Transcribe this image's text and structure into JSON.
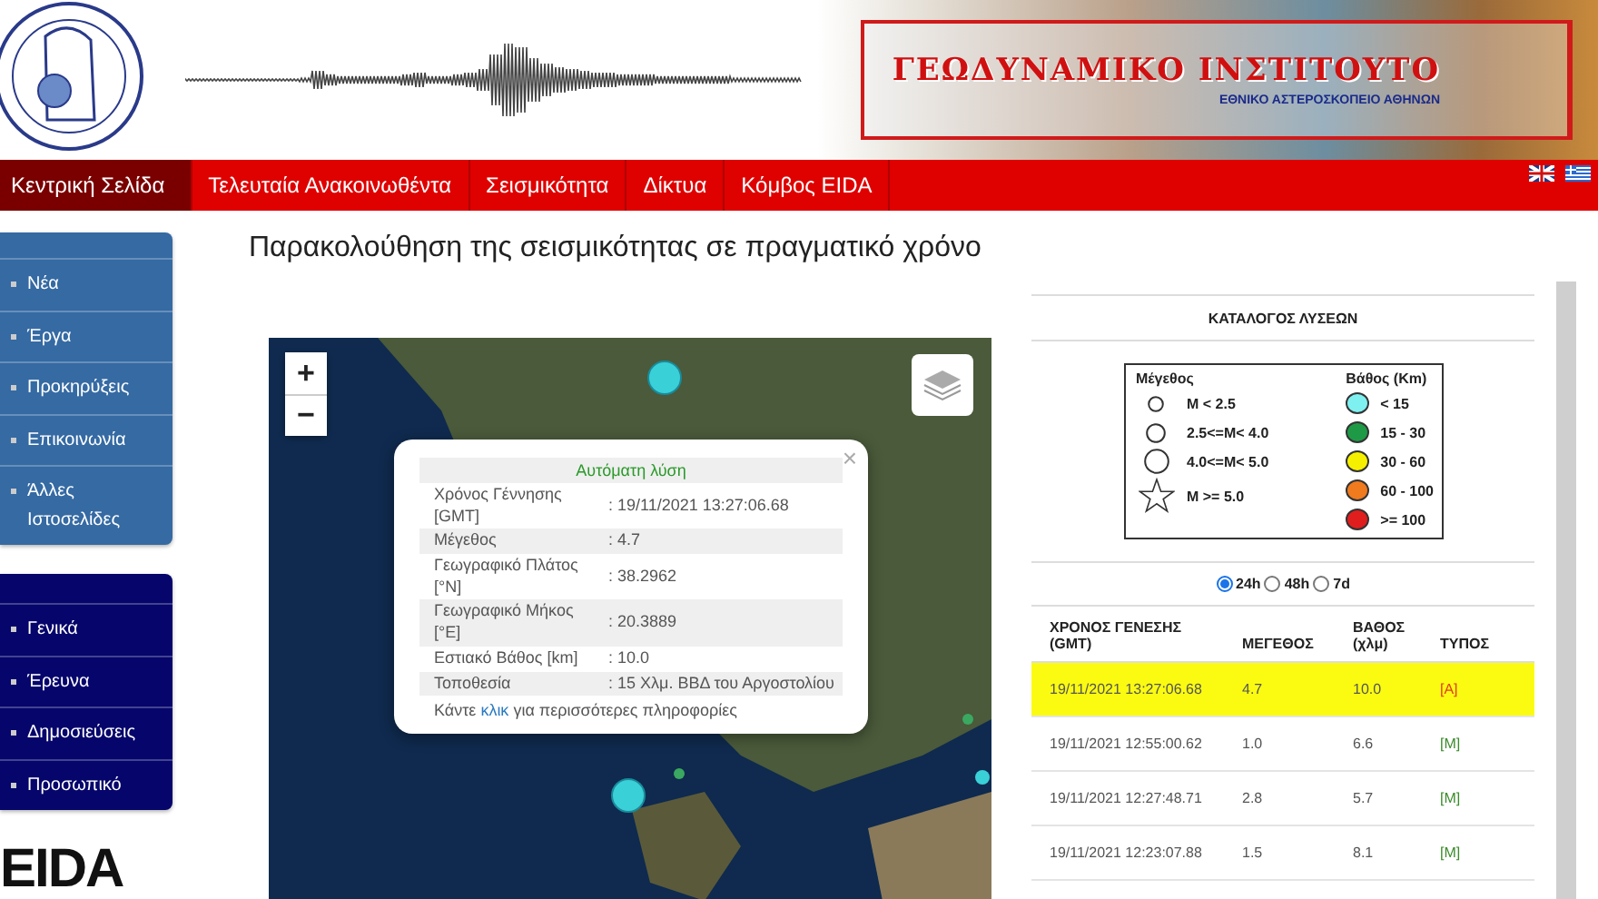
{
  "header": {
    "title": "ΓΕΩΔΥΝΑΜΙΚΟ ΙΝΣΤΙΤΟΥΤΟ",
    "subtitle": "ΕΘΝΙΚΟ ΑΣΤΕΡΟΣΚΟΠΕΙΟ ΑΘΗΝΩΝ"
  },
  "nav": [
    {
      "label": "Κεντρική Σελίδα",
      "selected": true
    },
    {
      "label": "Τελευταία Ανακοινωθέντα",
      "selected": false
    },
    {
      "label": "Σεισμικότητα",
      "selected": false
    },
    {
      "label": "Δίκτυα",
      "selected": false
    },
    {
      "label": "Κόμβος EIDA",
      "selected": false
    }
  ],
  "sidebar": {
    "groups": [
      {
        "items": [
          "Νέα",
          "Έργα",
          "Προκηρύξεις",
          "Επικοινωνία",
          "Άλλες Ιστοσελίδες"
        ]
      },
      {
        "items": [
          "Γενικά",
          "Έρευνα",
          "Δημοσιεύσεις",
          "Προσωπικό"
        ]
      }
    ],
    "logo": "EIDA"
  },
  "page_title": "Παρακολούθηση της σεισμικότητας σε πραγματικό χρόνο",
  "map": {
    "zoom_in": "+",
    "zoom_out": "−",
    "popup": {
      "title": "Αυτόματη λύση",
      "close": "×",
      "rows": [
        {
          "label": "Χρόνος Γέννησης [GMT]",
          "value": ": 19/11/2021 13:27:06.68"
        },
        {
          "label": "Μέγεθος",
          "value": ": 4.7"
        },
        {
          "label": "Γεωγραφικό Πλάτος [°N]",
          "value": ": 38.2962"
        },
        {
          "label": "Γεωγραφικό Μήκος [°E]",
          "value": ": 20.3889"
        },
        {
          "label": "Εστιακό Βάθος [km]",
          "value": ": 10.0"
        },
        {
          "label": "Τοποθεσία",
          "value": ": 15 Χλμ. ΒΒΔ του Αργοστολίου"
        }
      ],
      "footer": {
        "before": "Κάντε",
        "link": "κλικ",
        "after": "για περισσότερες πληροφορίες"
      }
    }
  },
  "catalog": {
    "title": "ΚΑΤΑΛΟΓΟΣ ΛΥΣΕΩΝ",
    "legend": {
      "size_title": "Μέγεθος",
      "depth_title": "Βάθος (Km)",
      "sizes": [
        {
          "kind": "small",
          "label": "M < 2.5"
        },
        {
          "kind": "medium",
          "label": "2.5<=M< 4.0"
        },
        {
          "kind": "large",
          "label": "4.0<=M< 5.0"
        },
        {
          "kind": "star",
          "label": "M >= 5.0"
        }
      ],
      "depths": [
        {
          "label": "< 15",
          "color": "#7ff0f0"
        },
        {
          "label": "15 - 30",
          "color": "#1e9a46"
        },
        {
          "label": "30 - 60",
          "color": "#f5f000"
        },
        {
          "label": "60 - 100",
          "color": "#f07a1e"
        },
        {
          "label": ">= 100",
          "color": "#e01e1e"
        }
      ]
    },
    "periods": [
      {
        "label": "24h",
        "selected": true
      },
      {
        "label": "48h",
        "selected": false
      },
      {
        "label": "7d",
        "selected": false
      }
    ],
    "columns": [
      "ΧΡΟΝΟΣ ΓΕΝΕΣΗΣ (GMT)",
      "ΜΕΓΕΘΟΣ",
      "ΒΑΘΟΣ (χλμ)",
      "ΤΥΠΟΣ"
    ],
    "rows": [
      {
        "time": "19/11/2021 13:27:06.68",
        "magnitude": "4.7",
        "depth": "10.0",
        "type": "[A]",
        "kind": "automatic",
        "selected": true
      },
      {
        "time": "19/11/2021 12:55:00.62",
        "magnitude": "1.0",
        "depth": "6.6",
        "type": "[M]",
        "kind": "manual",
        "selected": false
      },
      {
        "time": "19/11/2021 12:27:48.71",
        "magnitude": "2.8",
        "depth": "5.7",
        "type": "[M]",
        "kind": "manual",
        "selected": false
      },
      {
        "time": "19/11/2021 12:23:07.88",
        "magnitude": "1.5",
        "depth": "8.1",
        "type": "[M]",
        "kind": "manual",
        "selected": false
      }
    ]
  }
}
